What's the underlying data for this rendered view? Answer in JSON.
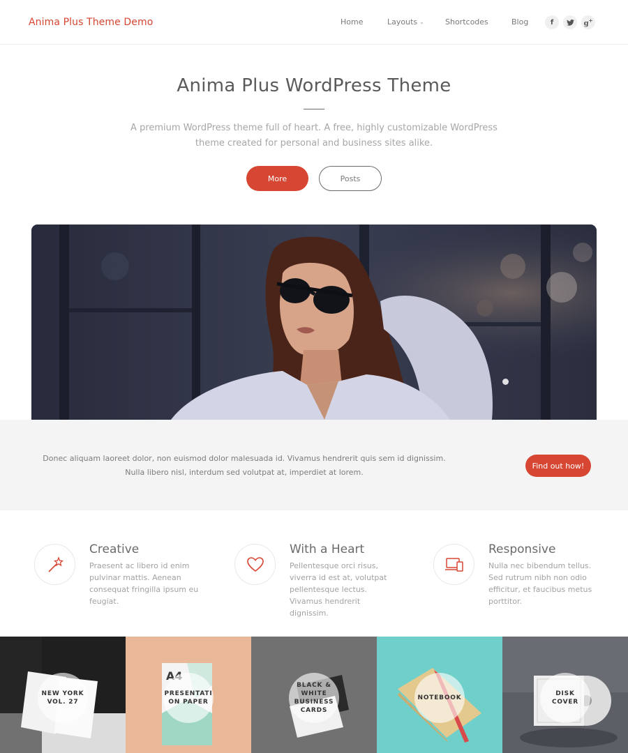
{
  "header": {
    "site_title": "Anima Plus Theme Demo",
    "nav": [
      {
        "label": "Home"
      },
      {
        "label": "Layouts"
      },
      {
        "label": "Shortcodes"
      },
      {
        "label": "Blog"
      }
    ],
    "social": [
      {
        "icon": "facebook-icon",
        "glyph": "f"
      },
      {
        "icon": "twitter-icon",
        "glyph": "t"
      },
      {
        "icon": "google-plus-icon",
        "glyph": "g+"
      }
    ]
  },
  "hero": {
    "title": "Anima Plus WordPress Theme",
    "text": "A premium WordPress theme full of heart. A free, highly customizable WordPress theme created for personal and business sites alike.",
    "btn_more": "More",
    "btn_posts": "Posts"
  },
  "callout": {
    "text": "Donec aliquam laoreet dolor, non euismod dolor malesuada id. Vivamus hendrerit quis sem id dignissim. Nulla libero nisl, interdum sed volutpat at, imperdiet at lorem.",
    "button": "Find out how!"
  },
  "features": [
    {
      "icon": "magic-wand-icon",
      "title": "Creative",
      "text": "Praesent ac libero id enim pulvinar mattis. Aenean consequat fringilla ipsum eu feugiat."
    },
    {
      "icon": "heart-icon",
      "title": "With a Heart",
      "text": "Pellentesque orci risus, viverra id est at, volutpat pellentesque lectus. Vivamus hendrerit dignissim."
    },
    {
      "icon": "devices-icon",
      "title": "Responsive",
      "text": "Nulla nec bibendum tellus. Sed rutrum nibh non odio efficitur, et faucibus metus porttitor."
    }
  ],
  "tiles": [
    {
      "label": "NEW YORK VOL. 27"
    },
    {
      "label": "PRESENTATI ON PAPER"
    },
    {
      "label": "BLACK & WHITE BUSINESS CARDS"
    },
    {
      "label": "NOTEBOOK"
    },
    {
      "label": "DISK COVER"
    }
  ],
  "colors": {
    "accent": "#d64632",
    "band_bg": "#f4f4f4"
  }
}
